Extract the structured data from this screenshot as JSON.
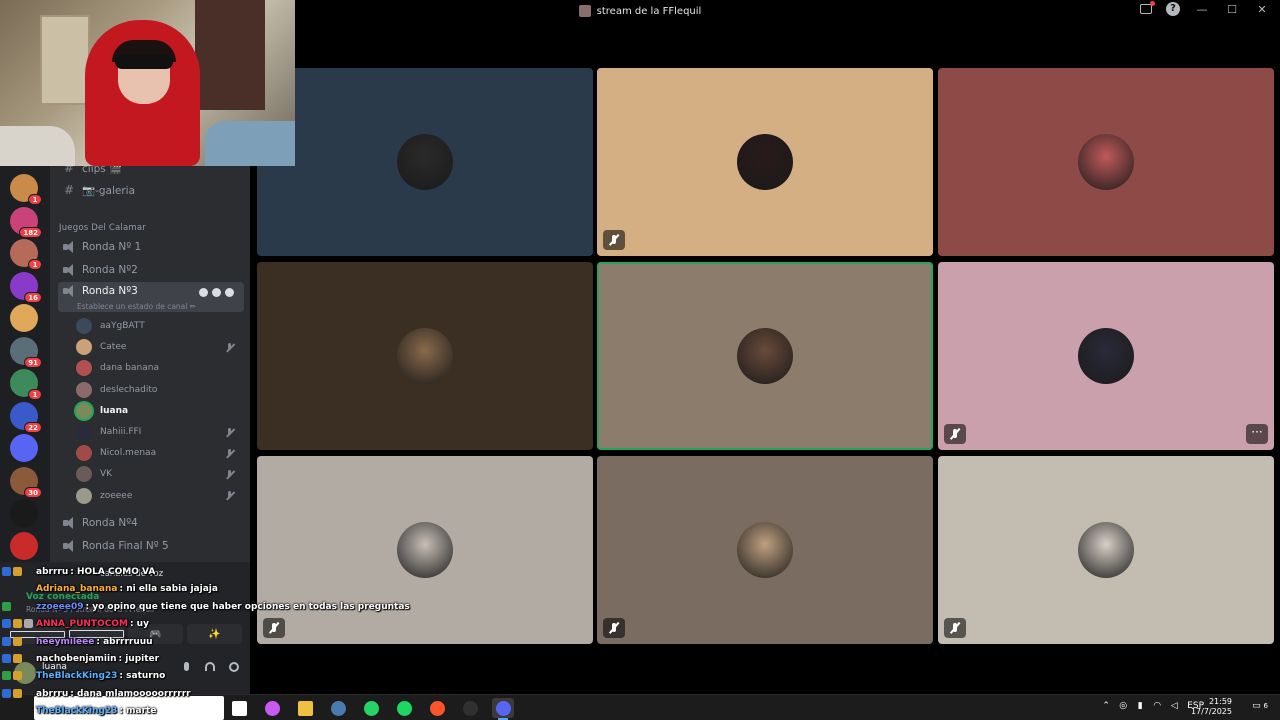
{
  "window": {
    "title": "stream de la FFlequil",
    "help_glyph": "?",
    "minimize_glyph": "—",
    "maximize_glyph": "☐",
    "close_glyph": "✕"
  },
  "servers": [
    {
      "badge": "1",
      "color": "#c98a4a"
    },
    {
      "badge": "182",
      "color": "#c9437a"
    },
    {
      "badge": "1",
      "color": "#b56a5a"
    },
    {
      "badge": "16",
      "color": "#8a3ac9"
    },
    {
      "badge": "",
      "color": "#e0a85a"
    },
    {
      "badge": "91",
      "color": "#5a6e7a"
    },
    {
      "badge": "1",
      "color": "#3d8a5a"
    },
    {
      "badge": "22",
      "color": "#3a5ac9"
    },
    {
      "badge": "",
      "color": "#5865f2"
    },
    {
      "badge": "30",
      "color": "#8a5a3a"
    },
    {
      "badge": "",
      "color": "#1a1a1a"
    },
    {
      "badge": "",
      "color": "#c92a2a"
    },
    {
      "badge": "",
      "color": "#d0d0d0"
    }
  ],
  "channels": {
    "top": [
      {
        "label": "clips 🎬",
        "kind": "text"
      },
      {
        "label": "📷-galeria",
        "kind": "text"
      }
    ],
    "category": "Juegos Del Calamar",
    "voice": [
      {
        "label": "Ronda Nº 1"
      },
      {
        "label": "Ronda Nº2"
      },
      {
        "label": "Ronda Nº3",
        "active": true
      }
    ],
    "status_hint": "Establece un estado de canal ✏",
    "members": [
      {
        "name": "aaYgBATT",
        "muted": false,
        "speaking": false,
        "color": "#3a4a5a"
      },
      {
        "name": "Catee",
        "muted": true,
        "speaking": false,
        "color": "#c9a27a"
      },
      {
        "name": "dana banana",
        "muted": false,
        "speaking": false,
        "color": "#b05050"
      },
      {
        "name": "deslechadito",
        "muted": false,
        "speaking": false,
        "color": "#8a6a6a"
      },
      {
        "name": "luana",
        "muted": false,
        "speaking": true,
        "color": "#7a8a5a"
      },
      {
        "name": "Nahiii.FFI",
        "muted": true,
        "speaking": false,
        "color": "#2a2a3a"
      },
      {
        "name": "Nicol.menaa",
        "muted": true,
        "speaking": false,
        "color": "#a04a4a"
      },
      {
        "name": "VK",
        "muted": true,
        "speaking": false,
        "color": "#6a5a5a"
      },
      {
        "name": "zoeeee",
        "muted": true,
        "speaking": false,
        "color": "#9a9a8a"
      }
    ],
    "after": [
      {
        "label": "Ronda Nº4"
      },
      {
        "label": "Ronda Final Nº 5"
      }
    ]
  },
  "lower_panel": {
    "overlay_text": "canales de voz",
    "voice_connected": "Voz conectada",
    "voice_channel": "Ronda Nº 3 / stream de la FFlequil",
    "username": "luana",
    "btn_glyphs": [
      "🎮",
      "✨"
    ]
  },
  "chat": [
    {
      "user": "abrrru",
      "msg": ": HOLA COMO VA",
      "color": "#ffffff",
      "badges": [
        "#2e6bd6",
        "#d6a02e"
      ]
    },
    {
      "user": "Adriana_banana",
      "msg": ": ni ella sabia jajaja",
      "color": "#ffb02e",
      "badges": []
    },
    {
      "user": "zzoeee09",
      "msg": ": yo opino que tiene que haber opciones en todas las preguntas",
      "color": "#6e8cff",
      "badges": [
        "#2ea043"
      ]
    },
    {
      "user": "ANNA_PUNTOCOM",
      "msg": ": uy",
      "color": "#ff2e5a",
      "badges": [
        "#2e6bd6",
        "#d6a02e",
        "#aaaaaa"
      ]
    },
    {
      "user": "heeymileee",
      "msg": ": abrrrruuu",
      "color": "#bb88ff",
      "badges": [
        "#2e6bd6",
        "#d6a02e"
      ]
    },
    {
      "user": "nachobenjamiin",
      "msg": ": jupiter",
      "color": "#ffffff",
      "badges": [
        "#2e6bd6",
        "#d6a02e"
      ]
    },
    {
      "user": "TheBlackKing23",
      "msg": ": saturno",
      "color": "#5ab0ff",
      "badges": [
        "#2ea043",
        "#d6a02e"
      ]
    },
    {
      "user": "abrrru",
      "msg": ": dana mlamooooorrrrrr",
      "color": "#ffffff",
      "badges": [
        "#2e6bd6",
        "#d6a02e"
      ]
    },
    {
      "user": "TheBlackKing23",
      "msg": ": marte",
      "color": "#5ab0ff",
      "badges": []
    }
  ],
  "tiles": [
    {
      "bg": "#2b3a4a",
      "avatar": "#2a2a2a",
      "muted": false,
      "speaking": false,
      "more": false
    },
    {
      "bg": "#d4af84",
      "avatar": "#2a1a1a",
      "muted": true,
      "speaking": false,
      "more": false
    },
    {
      "bg": "#8e4a47",
      "avatar": "#c05a5a",
      "muted": false,
      "speaking": false,
      "more": false
    },
    {
      "bg": "#3a2f22",
      "avatar": "#8a6a4a",
      "muted": false,
      "speaking": false,
      "more": false
    },
    {
      "bg": "#8c7c6c",
      "avatar": "#6a4a3a",
      "muted": false,
      "speaking": true,
      "more": false
    },
    {
      "bg": "#c9a0ab",
      "avatar": "#2a2a3a",
      "muted": true,
      "speaking": false,
      "more": true
    },
    {
      "bg": "#b2aba3",
      "avatar": "#c8c0b8",
      "muted": true,
      "speaking": false,
      "more": false
    },
    {
      "bg": "#7b6c62",
      "avatar": "#c0a080",
      "muted": true,
      "speaking": false,
      "more": false
    },
    {
      "bg": "#c2bcb1",
      "avatar": "#d8d0c8",
      "muted": true,
      "speaking": false,
      "more": false
    }
  ],
  "taskbar": {
    "apps": [
      {
        "name": "task-view",
        "color": "#ffffff"
      },
      {
        "name": "copilot",
        "color": "#c75af0"
      },
      {
        "name": "file-explorer",
        "color": "#f0c040"
      },
      {
        "name": "steam",
        "color": "#4a7ab0"
      },
      {
        "name": "whatsapp",
        "color": "#25d366"
      },
      {
        "name": "spotify",
        "color": "#1ed760"
      },
      {
        "name": "brave",
        "color": "#fb542b"
      },
      {
        "name": "obs",
        "color": "#303030"
      },
      {
        "name": "discord",
        "color": "#5865f2",
        "active": true
      }
    ],
    "tray": {
      "lang": "ESP"
    },
    "time": "21:59",
    "date": "17/7/2025",
    "notif_count": "6"
  }
}
